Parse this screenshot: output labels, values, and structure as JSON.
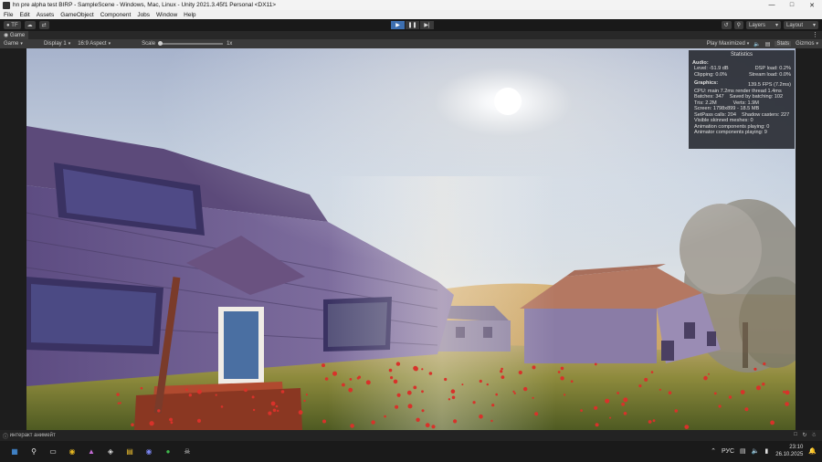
{
  "window": {
    "title": "hn pre alpha test BIRP - SampleScene - Windows, Mac, Linux - Unity 2021.3.45f1 Personal <DX11>",
    "minimize_icon": "minimize-icon",
    "maximize_icon": "maximize-icon",
    "close_icon": "close-icon"
  },
  "menu": [
    "File",
    "Edit",
    "Assets",
    "GameObject",
    "Component",
    "Jobs",
    "Window",
    "Help"
  ],
  "toolbar": {
    "account_label": "TF",
    "layers_label": "Layers",
    "layout_label": "Layout"
  },
  "game_tab": {
    "label": "Game",
    "mode": "Game",
    "display": "Display 1",
    "aspect": "16:9 Aspect",
    "scale_label": "Scale",
    "scale_value": "1x",
    "play_mode": "Play Maximized",
    "stats_label": "Stats",
    "gizmos_label": "Gizmos"
  },
  "stats": {
    "title": "Statistics",
    "audio_header": "Audio:",
    "level": "Level: -51.9 dB",
    "dsp": "DSP load: 0.2%",
    "clipping": "Clipping: 0.0%",
    "stream": "Stream load: 0.0%",
    "graphics_header": "Graphics:",
    "fps": "139.5 FPS (7.2ms)",
    "cpu": "CPU: main 7.2ms  render thread 1.4ms",
    "batches": "Batches: 347",
    "saved_batching": "Saved by batching: 102",
    "tris": "Tris: 2.2M",
    "verts": "Verts: 1.9M",
    "screen": "Screen: 1798x899 - 18.5 MB",
    "setpass": "SetPass calls: 204",
    "shadow": "Shadow casters: 227",
    "skinned": "Visible skinned meshes: 0",
    "anim_comp": "Animation components playing: 0",
    "animator_comp": "Animator components playing: 9"
  },
  "status": {
    "message": "интеракт анимейт"
  },
  "taskbar": {
    "lang": "РУС",
    "time": "23:10",
    "date": "26.10.2025",
    "icons": [
      "windows-start-icon",
      "search-icon",
      "task-view-icon",
      "chrome-icon",
      "app-icon",
      "unity-icon",
      "file-explorer-icon",
      "discord-icon",
      "xbox-icon",
      "game-icon"
    ]
  },
  "colors": {
    "play_active": "#3d6fb0",
    "sky_top": "#aeb8cf",
    "house_purple": "#6b5a8e",
    "grass": "#6e7a35",
    "flowers": "#d8322a"
  }
}
